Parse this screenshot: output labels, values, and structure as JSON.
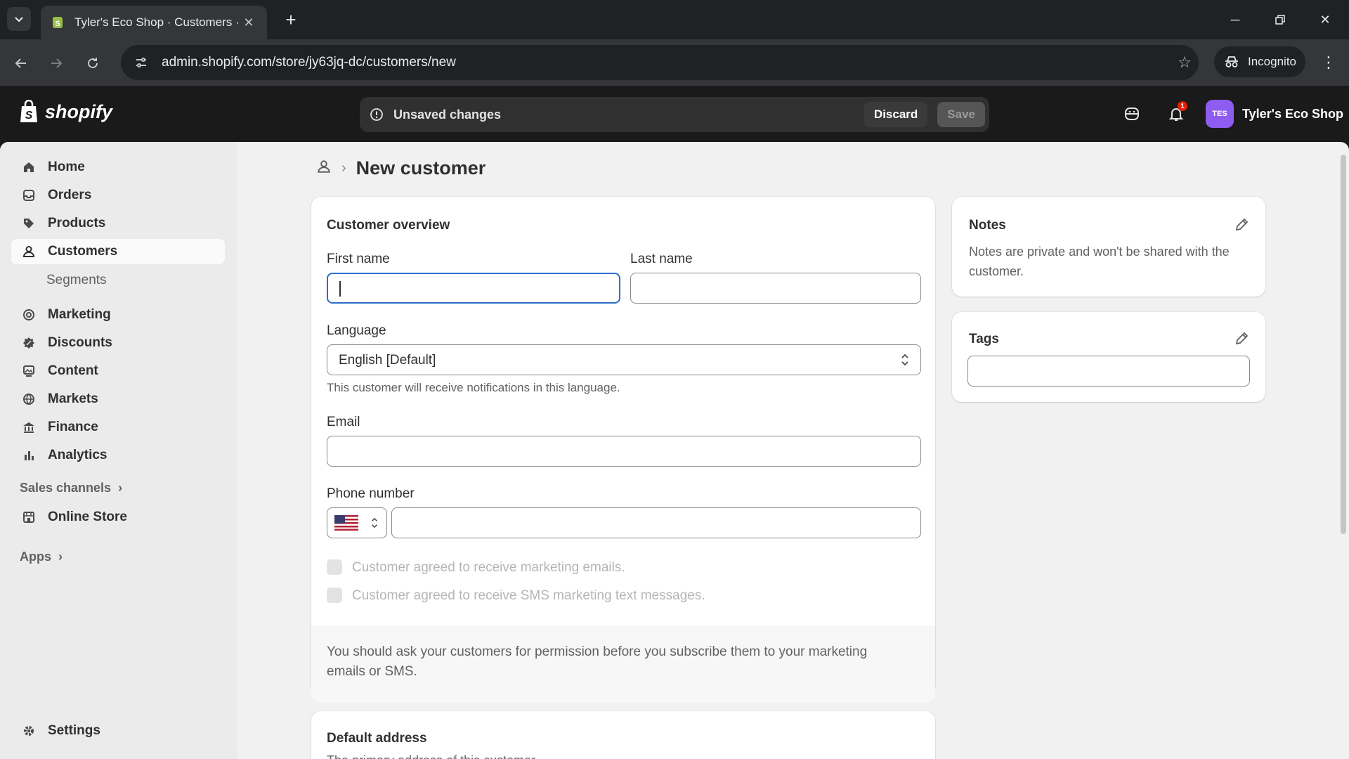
{
  "browser": {
    "tab_title": "Tyler's Eco Shop · Customers · N",
    "url": "admin.shopify.com/store/jy63jq-dc/customers/new",
    "incognito_label": "Incognito"
  },
  "topbar": {
    "logo": "shopify",
    "unsaved_message": "Unsaved changes",
    "discard_label": "Discard",
    "save_label": "Save",
    "notification_count": "1",
    "store_initials": "TES",
    "store_name": "Tyler's Eco Shop"
  },
  "sidebar": {
    "items": [
      {
        "label": "Home",
        "icon": "home-icon"
      },
      {
        "label": "Orders",
        "icon": "orders-icon"
      },
      {
        "label": "Products",
        "icon": "tag-icon"
      },
      {
        "label": "Customers",
        "icon": "person-icon"
      },
      {
        "label": "Segments"
      },
      {
        "label": "Marketing",
        "icon": "target-icon"
      },
      {
        "label": "Discounts",
        "icon": "discount-icon"
      },
      {
        "label": "Content",
        "icon": "content-icon"
      },
      {
        "label": "Markets",
        "icon": "globe-icon"
      },
      {
        "label": "Finance",
        "icon": "bank-icon"
      },
      {
        "label": "Analytics",
        "icon": "bar-chart-icon"
      }
    ],
    "sales_channels_label": "Sales channels",
    "online_store_label": "Online Store",
    "apps_label": "Apps",
    "settings_label": "Settings"
  },
  "page": {
    "title": "New customer"
  },
  "overview": {
    "title": "Customer overview",
    "first_name_label": "First name",
    "last_name_label": "Last name",
    "language_label": "Language",
    "language_value": "English [Default]",
    "language_help": "This customer will receive notifications in this language.",
    "email_label": "Email",
    "phone_label": "Phone number",
    "marketing_email_label": "Customer agreed to receive marketing emails.",
    "marketing_sms_label": "Customer agreed to receive SMS marketing text messages.",
    "permission_note": "You should ask your customers for permission before you subscribe them to your marketing emails or SMS."
  },
  "notes": {
    "title": "Notes",
    "text": "Notes are private and won't be shared with the customer."
  },
  "tags": {
    "title": "Tags"
  },
  "address": {
    "title": "Default address",
    "subtitle": "The primary address of this customer"
  }
}
